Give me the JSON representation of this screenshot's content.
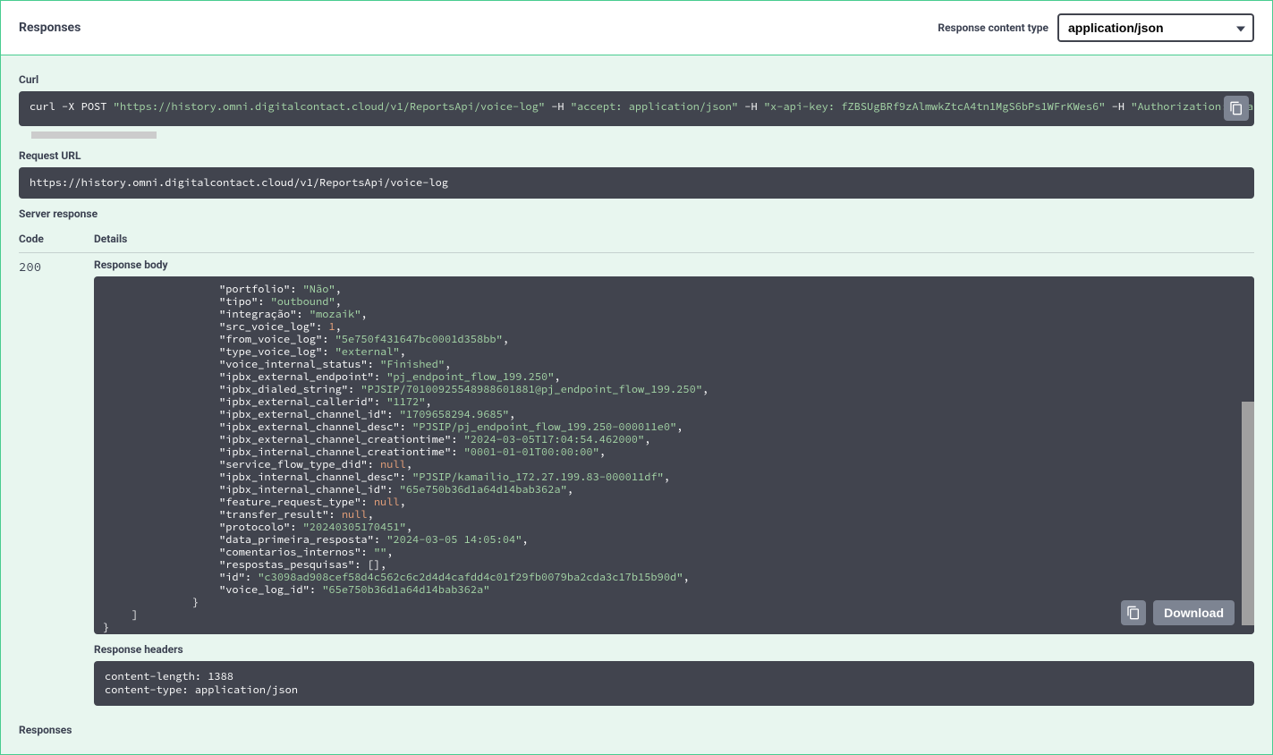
{
  "header": {
    "title": "Responses",
    "content_type_label": "Response content type",
    "content_type_value": "application/json"
  },
  "curl": {
    "title": "Curl",
    "cmd": "curl",
    "method_flag": "-X POST",
    "url": "\"https://history.omni.digitalcontact.cloud/v1/ReportsApi/voice-log\"",
    "h": "-H",
    "accept": "\"accept: application/json\"",
    "apikey": "\"x-api-key: fZBSUgBRf9zAlmwkZtcA4tn1MgS6bPs1WFrKWes6\"",
    "auth": "\"Authorization: Bearer eyJhbGciOiJ"
  },
  "request_url": {
    "title": "Request URL",
    "value": "https://history.omni.digitalcontact.cloud/v1/ReportsApi/voice-log"
  },
  "server_response_title": "Server response",
  "cols": {
    "code": "Code",
    "details": "Details"
  },
  "status": "200",
  "response_body_title": "Response body",
  "download_label": "Download",
  "body_lines": [
    {
      "indent": 5,
      "key": "portfolio",
      "val": "Não",
      "type": "str",
      "comma": true
    },
    {
      "indent": 5,
      "key": "tipo",
      "val": "outbound",
      "type": "str",
      "comma": true
    },
    {
      "indent": 5,
      "key": "integração",
      "val": "mozaik",
      "type": "str",
      "comma": true
    },
    {
      "indent": 5,
      "key": "src_voice_log",
      "val": "1",
      "type": "num",
      "comma": true
    },
    {
      "indent": 5,
      "key": "from_voice_log",
      "val": "5e750f431647bc0001d358bb",
      "type": "str",
      "comma": true
    },
    {
      "indent": 5,
      "key": "type_voice_log",
      "val": "external",
      "type": "str",
      "comma": true
    },
    {
      "indent": 5,
      "key": "voice_internal_status",
      "val": "Finished",
      "type": "str",
      "comma": true
    },
    {
      "indent": 5,
      "key": "ipbx_external_endpoint",
      "val": "pj_endpoint_flow_199.250",
      "type": "str",
      "comma": true
    },
    {
      "indent": 5,
      "key": "ipbx_dialed_string",
      "val": "PJSIP/70100925548988601881@pj_endpoint_flow_199.250",
      "type": "str",
      "comma": true
    },
    {
      "indent": 5,
      "key": "ipbx_external_callerid",
      "val": "1172",
      "type": "str",
      "comma": true
    },
    {
      "indent": 5,
      "key": "ipbx_external_channel_id",
      "val": "1709658294.9685",
      "type": "str",
      "comma": true
    },
    {
      "indent": 5,
      "key": "ipbx_external_channel_desc",
      "val": "PJSIP/pj_endpoint_flow_199.250-000011e0",
      "type": "str",
      "comma": true
    },
    {
      "indent": 5,
      "key": "ipbx_external_channel_creationtime",
      "val": "2024-03-05T17:04:54.462000",
      "type": "str",
      "comma": true
    },
    {
      "indent": 5,
      "key": "ipbx_internal_channel_creationtime",
      "val": "0001-01-01T00:00:00",
      "type": "str",
      "comma": true
    },
    {
      "indent": 5,
      "key": "service_flow_type_did",
      "val": "null",
      "type": "null",
      "comma": true
    },
    {
      "indent": 5,
      "key": "ipbx_internal_channel_desc",
      "val": "PJSIP/kamailio_172.27.199.83-000011df",
      "type": "str",
      "comma": true
    },
    {
      "indent": 5,
      "key": "ipbx_internal_channel_id",
      "val": "65e750b36d1a64d14bab362a",
      "type": "str",
      "comma": true
    },
    {
      "indent": 5,
      "key": "feature_request_type",
      "val": "null",
      "type": "null",
      "comma": true
    },
    {
      "indent": 5,
      "key": "transfer_result",
      "val": "null",
      "type": "null",
      "comma": true
    },
    {
      "indent": 5,
      "key": "protocolo",
      "val": "20240305170451",
      "type": "str",
      "comma": true
    },
    {
      "indent": 5,
      "key": "data_primeira_resposta",
      "val": "2024-03-05 14:05:04",
      "type": "str",
      "comma": true
    },
    {
      "indent": 5,
      "key": "comentarios_internos",
      "val": "",
      "type": "str",
      "comma": true
    },
    {
      "indent": 5,
      "key": "respostas_pesquisas",
      "val": "[]",
      "type": "raw",
      "comma": true
    },
    {
      "indent": 5,
      "key": "id",
      "val": "c3098ad908cef58d4c562c6c2d4d4cafdd4c01f29fb0079ba2cda3c17b15b90d",
      "type": "str",
      "comma": true
    },
    {
      "indent": 5,
      "key": "voice_log_id",
      "val": "65e750b36d1a64d14bab362a",
      "type": "str",
      "comma": false
    }
  ],
  "close_lines": [
    {
      "indent": 4,
      "text": "}"
    },
    {
      "indent": 3,
      "text": "]"
    },
    {
      "indent": 1,
      "text": "}"
    }
  ],
  "response_headers": {
    "title": "Response headers",
    "lines": [
      " content-length: 1388 ",
      " content-type: application/json "
    ]
  },
  "footer_title": "Responses"
}
